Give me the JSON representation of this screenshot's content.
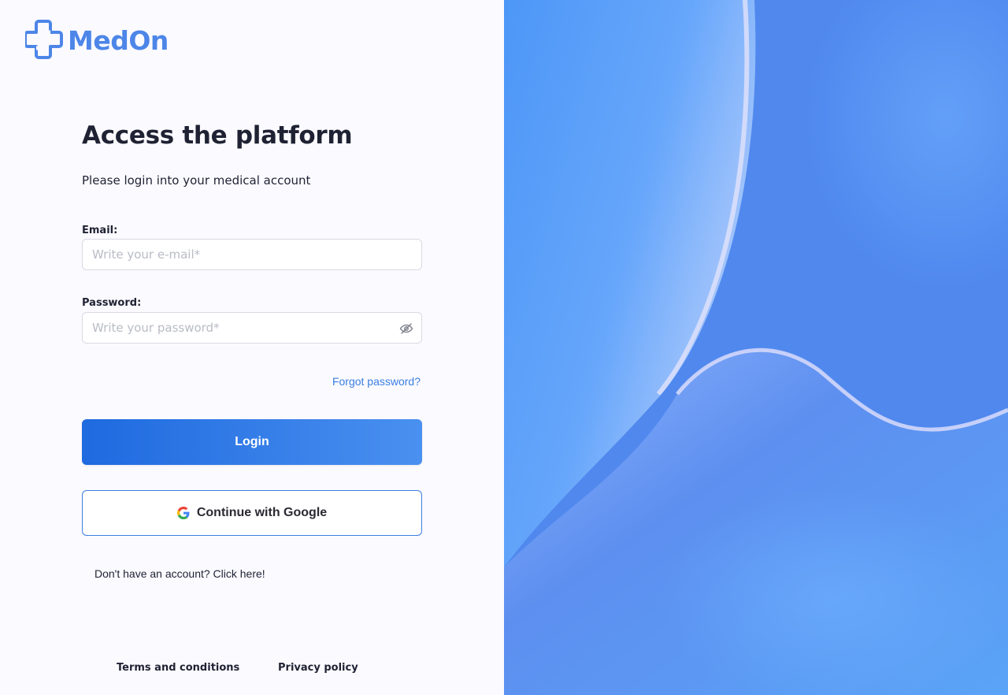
{
  "brand": {
    "name": "MedOn",
    "color": "#4d86e8"
  },
  "form": {
    "title": "Access the platform",
    "subtitle": "Please login into your medical account",
    "email_label": "Email:",
    "email_placeholder": "Write your e-mail*",
    "password_label": "Password:",
    "password_placeholder": "Write your password*",
    "forgot_password": "Forgot password?",
    "login_label": "Login",
    "google_label": "Continue with Google",
    "signup_text": "Don't have an account? Click here!"
  },
  "footer": {
    "terms": "Terms and conditions",
    "privacy": "Privacy policy"
  },
  "colors": {
    "accent": "#3a7fe0",
    "login_gradient_start": "#1e6adf",
    "login_gradient_end": "#4a90f0"
  },
  "icons": {
    "logo": "medical-cross-icon",
    "password_toggle": "eye-off-icon",
    "google": "google-icon"
  }
}
